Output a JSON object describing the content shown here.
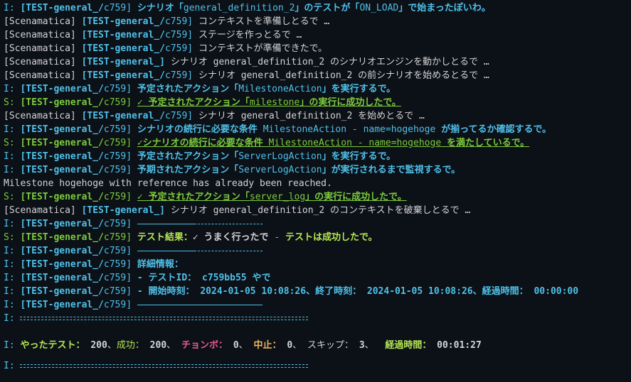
{
  "terminal": {
    "lines": [
      {
        "parts": [
          {
            "t": "I: ",
            "c": "info"
          },
          {
            "t": "[TEST-general_/",
            "c": "info",
            "b": true
          },
          {
            "t": "c759] ",
            "c": "info"
          },
          {
            "t": "シナリオ「",
            "c": "info",
            "b": true
          },
          {
            "t": "general_definition_2",
            "c": "info"
          },
          {
            "t": "」のテストが「",
            "c": "info",
            "b": true
          },
          {
            "t": "ON_LOAD",
            "c": "info"
          },
          {
            "t": "」で始まったぽいわ。",
            "c": "info",
            "b": true
          }
        ]
      },
      {
        "parts": [
          {
            "t": "[Scenamatica] ",
            "c": "white"
          },
          {
            "t": "[TEST-general_/",
            "c": "info",
            "b": true
          },
          {
            "t": "c759] ",
            "c": "info"
          },
          {
            "t": "コンテキストを準備しとるで …",
            "c": "white"
          }
        ]
      },
      {
        "parts": [
          {
            "t": "[Scenamatica] ",
            "c": "white"
          },
          {
            "t": "[TEST-general_/",
            "c": "info",
            "b": true
          },
          {
            "t": "c759] ",
            "c": "info"
          },
          {
            "t": "ステージを作っとるで …",
            "c": "white"
          }
        ]
      },
      {
        "parts": [
          {
            "t": "[Scenamatica] ",
            "c": "white"
          },
          {
            "t": "[TEST-general_/",
            "c": "info",
            "b": true
          },
          {
            "t": "c759] ",
            "c": "info"
          },
          {
            "t": "コンテキストが準備できたで。",
            "c": "white"
          }
        ]
      },
      {
        "parts": [
          {
            "t": "[Scenamatica] ",
            "c": "white"
          },
          {
            "t": "[TEST-general_] ",
            "c": "info",
            "b": true
          },
          {
            "t": "シナリオ general_definition_2 のシナリオエンジンを動かしとるで …",
            "c": "white"
          }
        ]
      },
      {
        "parts": [
          {
            "t": "[Scenamatica] ",
            "c": "white"
          },
          {
            "t": "[TEST-general_/",
            "c": "info",
            "b": true
          },
          {
            "t": "c759] ",
            "c": "info"
          },
          {
            "t": "シナリオ general_definition_2 の前シナリオを始めるとるで …",
            "c": "white"
          }
        ]
      },
      {
        "parts": [
          {
            "t": "I: ",
            "c": "info"
          },
          {
            "t": "[TEST-general_/",
            "c": "info",
            "b": true
          },
          {
            "t": "c759] ",
            "c": "info"
          },
          {
            "t": "予定されたアクション「",
            "c": "info",
            "b": true
          },
          {
            "t": "MilestoneAction",
            "c": "info"
          },
          {
            "t": "」を実行するで。",
            "c": "info",
            "b": true
          }
        ]
      },
      {
        "parts": [
          {
            "t": "S: ",
            "c": "succ"
          },
          {
            "t": "[TEST-general_/",
            "c": "succ",
            "b": true
          },
          {
            "t": "c759] ",
            "c": "succ"
          },
          {
            "t": "✓ 予定されたアクション「",
            "c": "succ",
            "b": true,
            "u": true
          },
          {
            "t": "milestone",
            "c": "succ",
            "u": true
          },
          {
            "t": "」の実行に成功したで。",
            "c": "succ",
            "b": true,
            "u": true
          }
        ]
      },
      {
        "parts": [
          {
            "t": "[Scenamatica] ",
            "c": "white"
          },
          {
            "t": "[TEST-general_/",
            "c": "info",
            "b": true
          },
          {
            "t": "c759] ",
            "c": "info"
          },
          {
            "t": "シナリオ general_definition_2 を始めとるで …",
            "c": "white"
          }
        ]
      },
      {
        "parts": [
          {
            "t": "I: ",
            "c": "info"
          },
          {
            "t": "[TEST-general_/",
            "c": "info",
            "b": true
          },
          {
            "t": "c759] ",
            "c": "info"
          },
          {
            "t": "シナリオの続行に必要な条件 ",
            "c": "info",
            "b": true
          },
          {
            "t": "MilestoneAction - name=hogehoge",
            "c": "info"
          },
          {
            "t": " が揃ってるか確認するで。",
            "c": "info",
            "b": true
          }
        ]
      },
      {
        "parts": [
          {
            "t": "S: ",
            "c": "succ"
          },
          {
            "t": "[TEST-general_/",
            "c": "succ",
            "b": true
          },
          {
            "t": "c759] ",
            "c": "succ"
          },
          {
            "t": "✓シナリオの続行に必要な条件 ",
            "c": "succ",
            "b": true,
            "u": true
          },
          {
            "t": "MilestoneAction - name=hogehoge",
            "c": "succ",
            "u": true
          },
          {
            "t": " を満たしているで。",
            "c": "succ",
            "b": true,
            "u": true
          }
        ]
      },
      {
        "parts": [
          {
            "t": "I: ",
            "c": "info"
          },
          {
            "t": "[TEST-general_/",
            "c": "info",
            "b": true
          },
          {
            "t": "c759] ",
            "c": "info"
          },
          {
            "t": "予定されたアクション「",
            "c": "info",
            "b": true
          },
          {
            "t": "ServerLogAction",
            "c": "info"
          },
          {
            "t": "」を実行するで。",
            "c": "info",
            "b": true
          }
        ]
      },
      {
        "parts": [
          {
            "t": "I: ",
            "c": "info"
          },
          {
            "t": "[TEST-general_/",
            "c": "info",
            "b": true
          },
          {
            "t": "c759] ",
            "c": "info"
          },
          {
            "t": "予期されたアクション「",
            "c": "info",
            "b": true
          },
          {
            "t": "ServerLogAction",
            "c": "info"
          },
          {
            "t": "」が実行されるまで監視するで。",
            "c": "info",
            "b": true
          }
        ]
      },
      {
        "parts": [
          {
            "t": "Milestone hogehoge with reference has already been reached.",
            "c": "white"
          }
        ]
      },
      {
        "parts": [
          {
            "t": "S: ",
            "c": "succ"
          },
          {
            "t": "[TEST-general_/",
            "c": "succ",
            "b": true
          },
          {
            "t": "c759] ",
            "c": "succ"
          },
          {
            "t": "✓ 予定されたアクション「",
            "c": "succ",
            "b": true,
            "u": true
          },
          {
            "t": "server_log",
            "c": "succ",
            "u": true
          },
          {
            "t": "」の実行に成功したで。",
            "c": "succ",
            "b": true,
            "u": true
          }
        ]
      },
      {
        "parts": [
          {
            "t": "[Scenamatica] ",
            "c": "white"
          },
          {
            "t": "[TEST-general_] ",
            "c": "info",
            "b": true
          },
          {
            "t": "シナリオ general_definition_2 のコンテキストを破棄しとるで …",
            "c": "white"
          }
        ]
      },
      {
        "parts": [
          {
            "t": "I: ",
            "c": "info"
          },
          {
            "t": "[TEST-general_/",
            "c": "info",
            "b": true
          },
          {
            "t": "c759] ",
            "c": "info"
          },
          {
            "rule": "line",
            "w": 80
          },
          {
            "rule": "dash",
            "w": 96
          }
        ]
      },
      {
        "parts": [
          {
            "t": "S: ",
            "c": "succ"
          },
          {
            "t": "[TEST-general_/",
            "c": "succ",
            "b": true
          },
          {
            "t": "c759] ",
            "c": "succ"
          },
          {
            "t": "テスト結果：",
            "c": "lime",
            "b": true
          },
          {
            "t": "✓ うまく行ったで",
            "c": "white",
            "b": true
          },
          {
            "t": " - ",
            "c": "info"
          },
          {
            "t": "テストは成功したで。",
            "c": "lime",
            "b": true
          }
        ]
      },
      {
        "parts": [
          {
            "t": "I: ",
            "c": "info"
          },
          {
            "t": "[TEST-general_/",
            "c": "info",
            "b": true
          },
          {
            "t": "c759] ",
            "c": "info"
          },
          {
            "rule": "line",
            "w": 80
          },
          {
            "rule": "dash",
            "w": 96
          }
        ]
      },
      {
        "parts": [
          {
            "t": "I: ",
            "c": "info"
          },
          {
            "t": "[TEST-general_/",
            "c": "info",
            "b": true
          },
          {
            "t": "c759] ",
            "c": "info"
          },
          {
            "t": "詳細情報：",
            "c": "info",
            "b": true
          }
        ]
      },
      {
        "parts": [
          {
            "t": "I: ",
            "c": "info"
          },
          {
            "t": "[TEST-general_/",
            "c": "info",
            "b": true
          },
          {
            "t": "c759] ",
            "c": "info"
          },
          {
            "t": "- テストID：",
            "c": "info",
            "b": true
          },
          {
            "t": " c759bb55",
            "c": "info",
            "b": true
          },
          {
            "t": " やで",
            "c": "info",
            "b": true
          }
        ]
      },
      {
        "parts": [
          {
            "t": "I: ",
            "c": "info"
          },
          {
            "t": "[TEST-general_/",
            "c": "info",
            "b": true
          },
          {
            "t": "c759] ",
            "c": "info"
          },
          {
            "t": "- 開始時刻：",
            "c": "info",
            "b": true
          },
          {
            "t": " 2024-01-05 10:08:26",
            "c": "info",
            "b": true
          },
          {
            "t": "、終了時刻：",
            "c": "info",
            "b": true
          },
          {
            "t": " 2024-01-05 10:08:26",
            "c": "info",
            "b": true
          },
          {
            "t": "、経過時間：",
            "c": "info",
            "b": true
          },
          {
            "t": " 00:00:00",
            "c": "info",
            "b": true
          }
        ]
      },
      {
        "parts": [
          {
            "t": "I: ",
            "c": "info"
          },
          {
            "t": "[TEST-general_/",
            "c": "info",
            "b": true
          },
          {
            "t": "c759] ",
            "c": "info"
          },
          {
            "rule": "line",
            "w": 176
          }
        ]
      },
      {
        "parts": [
          {
            "t": "I: ",
            "c": "info"
          },
          {
            "rule": "double",
            "w": 405
          }
        ]
      },
      {
        "blank": true
      },
      {
        "parts": [
          {
            "t": "I: ",
            "c": "info"
          },
          {
            "t": "やったテスト：",
            "c": "lime",
            "b": true
          },
          {
            "t": " 200",
            "c": "white",
            "b": true
          },
          {
            "t": "、",
            "c": "white"
          },
          {
            "t": "成功：",
            "c": "lime"
          },
          {
            "t": " 200",
            "c": "white",
            "b": true
          },
          {
            "t": "、 ",
            "c": "white"
          },
          {
            "t": "チョンボ：",
            "c": "red",
            "b": true
          },
          {
            "t": " 0",
            "c": "white",
            "b": true
          },
          {
            "t": "、 ",
            "c": "white"
          },
          {
            "t": "中止：",
            "c": "gold",
            "b": true
          },
          {
            "t": " 0",
            "c": "white",
            "b": true
          },
          {
            "t": "、 ",
            "c": "white"
          },
          {
            "t": "スキップ：",
            "c": "white"
          },
          {
            "t": " 3",
            "c": "white",
            "b": true
          },
          {
            "t": "、  ",
            "c": "white"
          },
          {
            "t": "経過時間：",
            "c": "lime",
            "b": true
          },
          {
            "t": " 00:01:27",
            "c": "white",
            "b": true
          }
        ]
      },
      {
        "spacer": true
      },
      {
        "parts": [
          {
            "t": "I: ",
            "c": "info"
          },
          {
            "rule": "double",
            "w": 405
          }
        ]
      }
    ]
  }
}
